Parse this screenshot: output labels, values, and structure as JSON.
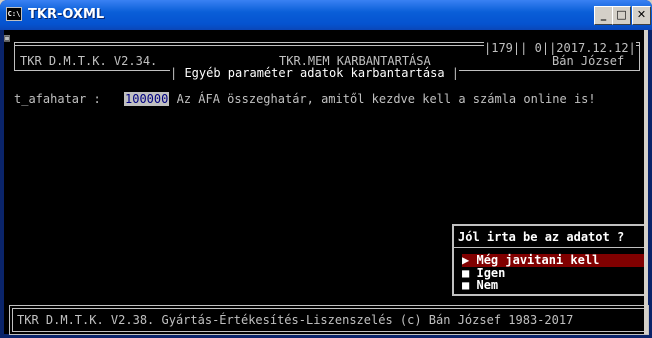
{
  "window": {
    "title": "TKR-OXML",
    "icon_label": "C:\\",
    "minimize_label": "_",
    "maximize_label": "□",
    "close_label": "✕"
  },
  "header": {
    "product": "TKR D.M.T.K. V2.34.",
    "module": "TKR.MEM KARBANTARTÁSA",
    "subtitle": "Egyéb paraméter adatok karbantartása",
    "counter_a": "179",
    "counter_b": "0",
    "date": "2017.12.12",
    "user": "Bán József"
  },
  "field": {
    "name": "t_afahatar :",
    "value": "100000",
    "description": "Az ÁFA összeghatár, amitől kezdve kell a számla online is!"
  },
  "dialog": {
    "title": "Jól irta be az adatot ?",
    "options": [
      {
        "marker": "▶",
        "label": "Még javitani kell",
        "selected": true
      },
      {
        "marker": "■",
        "label": "Igen",
        "selected": false
      },
      {
        "marker": "■",
        "label": "Nem",
        "selected": false
      }
    ]
  },
  "footer": {
    "text": "TKR D.M.T.K. V2.38. Gyártás-Értékesítés-Liszenszelés (c) Bán József 1983-2017"
  },
  "colors": {
    "console_bg": "#000000",
    "console_fg": "#c0c0c0",
    "selection": "#800000",
    "titlebar": "#0a5fd8"
  }
}
